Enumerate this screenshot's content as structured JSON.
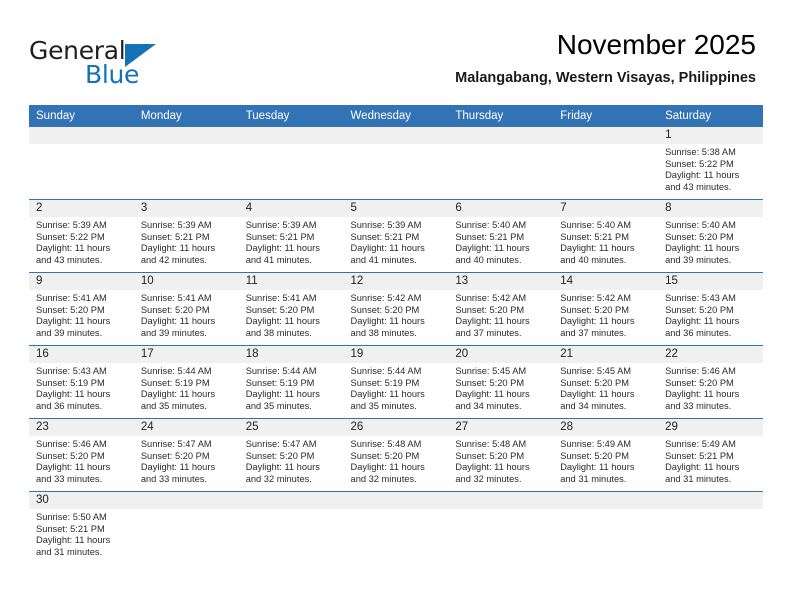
{
  "brand": {
    "name_part1": "General",
    "name_part2": "Blue",
    "accent_color": "#1473b8",
    "logo_icon": "triangle-icon"
  },
  "header": {
    "title": "November 2025",
    "subtitle": "Malangabang, Western Visayas, Philippines"
  },
  "calendar": {
    "header_bg": "#3273b5",
    "weekdays": [
      "Sunday",
      "Monday",
      "Tuesday",
      "Wednesday",
      "Thursday",
      "Friday",
      "Saturday"
    ],
    "weeks": [
      [
        {
          "day": "",
          "empty": true
        },
        {
          "day": "",
          "empty": true
        },
        {
          "day": "",
          "empty": true
        },
        {
          "day": "",
          "empty": true
        },
        {
          "day": "",
          "empty": true
        },
        {
          "day": "",
          "empty": true
        },
        {
          "day": "1",
          "sunrise": "Sunrise: 5:38 AM",
          "sunset": "Sunset: 5:22 PM",
          "daylight1": "Daylight: 11 hours",
          "daylight2": "and 43 minutes."
        }
      ],
      [
        {
          "day": "2",
          "sunrise": "Sunrise: 5:39 AM",
          "sunset": "Sunset: 5:22 PM",
          "daylight1": "Daylight: 11 hours",
          "daylight2": "and 43 minutes."
        },
        {
          "day": "3",
          "sunrise": "Sunrise: 5:39 AM",
          "sunset": "Sunset: 5:21 PM",
          "daylight1": "Daylight: 11 hours",
          "daylight2": "and 42 minutes."
        },
        {
          "day": "4",
          "sunrise": "Sunrise: 5:39 AM",
          "sunset": "Sunset: 5:21 PM",
          "daylight1": "Daylight: 11 hours",
          "daylight2": "and 41 minutes."
        },
        {
          "day": "5",
          "sunrise": "Sunrise: 5:39 AM",
          "sunset": "Sunset: 5:21 PM",
          "daylight1": "Daylight: 11 hours",
          "daylight2": "and 41 minutes."
        },
        {
          "day": "6",
          "sunrise": "Sunrise: 5:40 AM",
          "sunset": "Sunset: 5:21 PM",
          "daylight1": "Daylight: 11 hours",
          "daylight2": "and 40 minutes."
        },
        {
          "day": "7",
          "sunrise": "Sunrise: 5:40 AM",
          "sunset": "Sunset: 5:21 PM",
          "daylight1": "Daylight: 11 hours",
          "daylight2": "and 40 minutes."
        },
        {
          "day": "8",
          "sunrise": "Sunrise: 5:40 AM",
          "sunset": "Sunset: 5:20 PM",
          "daylight1": "Daylight: 11 hours",
          "daylight2": "and 39 minutes."
        }
      ],
      [
        {
          "day": "9",
          "sunrise": "Sunrise: 5:41 AM",
          "sunset": "Sunset: 5:20 PM",
          "daylight1": "Daylight: 11 hours",
          "daylight2": "and 39 minutes."
        },
        {
          "day": "10",
          "sunrise": "Sunrise: 5:41 AM",
          "sunset": "Sunset: 5:20 PM",
          "daylight1": "Daylight: 11 hours",
          "daylight2": "and 39 minutes."
        },
        {
          "day": "11",
          "sunrise": "Sunrise: 5:41 AM",
          "sunset": "Sunset: 5:20 PM",
          "daylight1": "Daylight: 11 hours",
          "daylight2": "and 38 minutes."
        },
        {
          "day": "12",
          "sunrise": "Sunrise: 5:42 AM",
          "sunset": "Sunset: 5:20 PM",
          "daylight1": "Daylight: 11 hours",
          "daylight2": "and 38 minutes."
        },
        {
          "day": "13",
          "sunrise": "Sunrise: 5:42 AM",
          "sunset": "Sunset: 5:20 PM",
          "daylight1": "Daylight: 11 hours",
          "daylight2": "and 37 minutes."
        },
        {
          "day": "14",
          "sunrise": "Sunrise: 5:42 AM",
          "sunset": "Sunset: 5:20 PM",
          "daylight1": "Daylight: 11 hours",
          "daylight2": "and 37 minutes."
        },
        {
          "day": "15",
          "sunrise": "Sunrise: 5:43 AM",
          "sunset": "Sunset: 5:20 PM",
          "daylight1": "Daylight: 11 hours",
          "daylight2": "and 36 minutes."
        }
      ],
      [
        {
          "day": "16",
          "sunrise": "Sunrise: 5:43 AM",
          "sunset": "Sunset: 5:19 PM",
          "daylight1": "Daylight: 11 hours",
          "daylight2": "and 36 minutes."
        },
        {
          "day": "17",
          "sunrise": "Sunrise: 5:44 AM",
          "sunset": "Sunset: 5:19 PM",
          "daylight1": "Daylight: 11 hours",
          "daylight2": "and 35 minutes."
        },
        {
          "day": "18",
          "sunrise": "Sunrise: 5:44 AM",
          "sunset": "Sunset: 5:19 PM",
          "daylight1": "Daylight: 11 hours",
          "daylight2": "and 35 minutes."
        },
        {
          "day": "19",
          "sunrise": "Sunrise: 5:44 AM",
          "sunset": "Sunset: 5:19 PM",
          "daylight1": "Daylight: 11 hours",
          "daylight2": "and 35 minutes."
        },
        {
          "day": "20",
          "sunrise": "Sunrise: 5:45 AM",
          "sunset": "Sunset: 5:20 PM",
          "daylight1": "Daylight: 11 hours",
          "daylight2": "and 34 minutes."
        },
        {
          "day": "21",
          "sunrise": "Sunrise: 5:45 AM",
          "sunset": "Sunset: 5:20 PM",
          "daylight1": "Daylight: 11 hours",
          "daylight2": "and 34 minutes."
        },
        {
          "day": "22",
          "sunrise": "Sunrise: 5:46 AM",
          "sunset": "Sunset: 5:20 PM",
          "daylight1": "Daylight: 11 hours",
          "daylight2": "and 33 minutes."
        }
      ],
      [
        {
          "day": "23",
          "sunrise": "Sunrise: 5:46 AM",
          "sunset": "Sunset: 5:20 PM",
          "daylight1": "Daylight: 11 hours",
          "daylight2": "and 33 minutes."
        },
        {
          "day": "24",
          "sunrise": "Sunrise: 5:47 AM",
          "sunset": "Sunset: 5:20 PM",
          "daylight1": "Daylight: 11 hours",
          "daylight2": "and 33 minutes."
        },
        {
          "day": "25",
          "sunrise": "Sunrise: 5:47 AM",
          "sunset": "Sunset: 5:20 PM",
          "daylight1": "Daylight: 11 hours",
          "daylight2": "and 32 minutes."
        },
        {
          "day": "26",
          "sunrise": "Sunrise: 5:48 AM",
          "sunset": "Sunset: 5:20 PM",
          "daylight1": "Daylight: 11 hours",
          "daylight2": "and 32 minutes."
        },
        {
          "day": "27",
          "sunrise": "Sunrise: 5:48 AM",
          "sunset": "Sunset: 5:20 PM",
          "daylight1": "Daylight: 11 hours",
          "daylight2": "and 32 minutes."
        },
        {
          "day": "28",
          "sunrise": "Sunrise: 5:49 AM",
          "sunset": "Sunset: 5:20 PM",
          "daylight1": "Daylight: 11 hours",
          "daylight2": "and 31 minutes."
        },
        {
          "day": "29",
          "sunrise": "Sunrise: 5:49 AM",
          "sunset": "Sunset: 5:21 PM",
          "daylight1": "Daylight: 11 hours",
          "daylight2": "and 31 minutes."
        }
      ],
      [
        {
          "day": "30",
          "sunrise": "Sunrise: 5:50 AM",
          "sunset": "Sunset: 5:21 PM",
          "daylight1": "Daylight: 11 hours",
          "daylight2": "and 31 minutes."
        },
        {
          "day": "",
          "empty": true
        },
        {
          "day": "",
          "empty": true
        },
        {
          "day": "",
          "empty": true
        },
        {
          "day": "",
          "empty": true
        },
        {
          "day": "",
          "empty": true
        },
        {
          "day": "",
          "empty": true
        }
      ]
    ]
  }
}
